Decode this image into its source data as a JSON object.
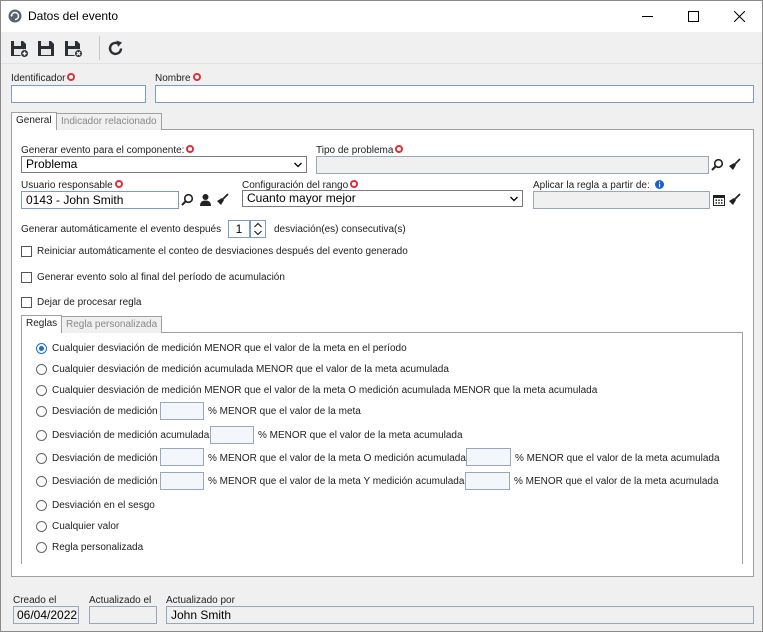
{
  "window": {
    "title": "Datos del evento"
  },
  "header": {
    "identificador_label": "Identificador",
    "identificador_value": "",
    "nombre_label": "Nombre",
    "nombre_value": ""
  },
  "tabs": [
    {
      "label": "General",
      "active": true
    },
    {
      "label": "Indicador relacionado",
      "active": false
    }
  ],
  "general": {
    "generar_evento_label": "Generar evento para el componente:",
    "generar_evento_value": "Problema",
    "tipo_problema_label": "Tipo de problema",
    "tipo_problema_value": "",
    "usuario_label": "Usuario responsable",
    "usuario_value": "0143 - John Smith",
    "config_rango_label": "Configuración del rango",
    "config_rango_value": "Cuanto mayor mejor",
    "aplicar_regla_label": "Aplicar la regla a partir de:",
    "aplicar_regla_value": "",
    "auto_evento_label": "Generar automáticamente el evento después",
    "auto_evento_value": "1",
    "auto_evento_suffix": "desviación(es) consecutiva(s)",
    "check_reiniciar": "Reiniciar automáticamente el conteo de desviaciones después del evento generado",
    "check_final_periodo": "Generar evento solo al final del período de acumulación",
    "check_dejar": "Dejar de procesar regla"
  },
  "inner_tabs": [
    {
      "label": "Reglas",
      "active": true
    },
    {
      "label": "Regla personalizada",
      "active": false
    }
  ],
  "rules": {
    "r1": "Cualquier desviación de medición MENOR que el valor de la meta en el período",
    "r2": "Cualquier desviación de medición acumulada MENOR que el valor de la meta acumulada",
    "r3": "Cualquier desviación de medición MENOR que el valor de la meta O medición acumulada MENOR que la meta acumulada",
    "r4_a": "Desviación de medición",
    "r4_b": "% MENOR que el valor de la meta",
    "r5_a": "Desviación de medición acumulada",
    "r5_b": "% MENOR que el valor de la meta acumulada",
    "r6_a": "Desviación de medición",
    "r6_b": "% MENOR que el valor de la meta O medición acumulada",
    "r6_c": "% MENOR que el valor de la meta acumulada",
    "r7_a": "Desviación de medición",
    "r7_b": "% MENOR que el valor de la meta Y medición acumulada",
    "r7_c": "% MENOR que el valor de la meta acumulada",
    "r8": "Desviación en el sesgo",
    "r9": "Cualquier valor",
    "r10": "Regla personalizada",
    "selected": "r1"
  },
  "footer": {
    "creado_label": "Creado el",
    "creado_value": "06/04/2022",
    "actualizado_label": "Actualizado el",
    "actualizado_value": "",
    "actualizado_por_label": "Actualizado por",
    "actualizado_por_value": "John Smith"
  },
  "icons": {
    "app": "refresh-globe-icon",
    "save_new": "save-new-icon",
    "save": "save-icon",
    "save_close": "save-close-icon",
    "reload": "reload-icon"
  },
  "colors": {
    "required": "#e0303a",
    "accent": "#1a6fd0",
    "info": "#1a5fd0"
  }
}
